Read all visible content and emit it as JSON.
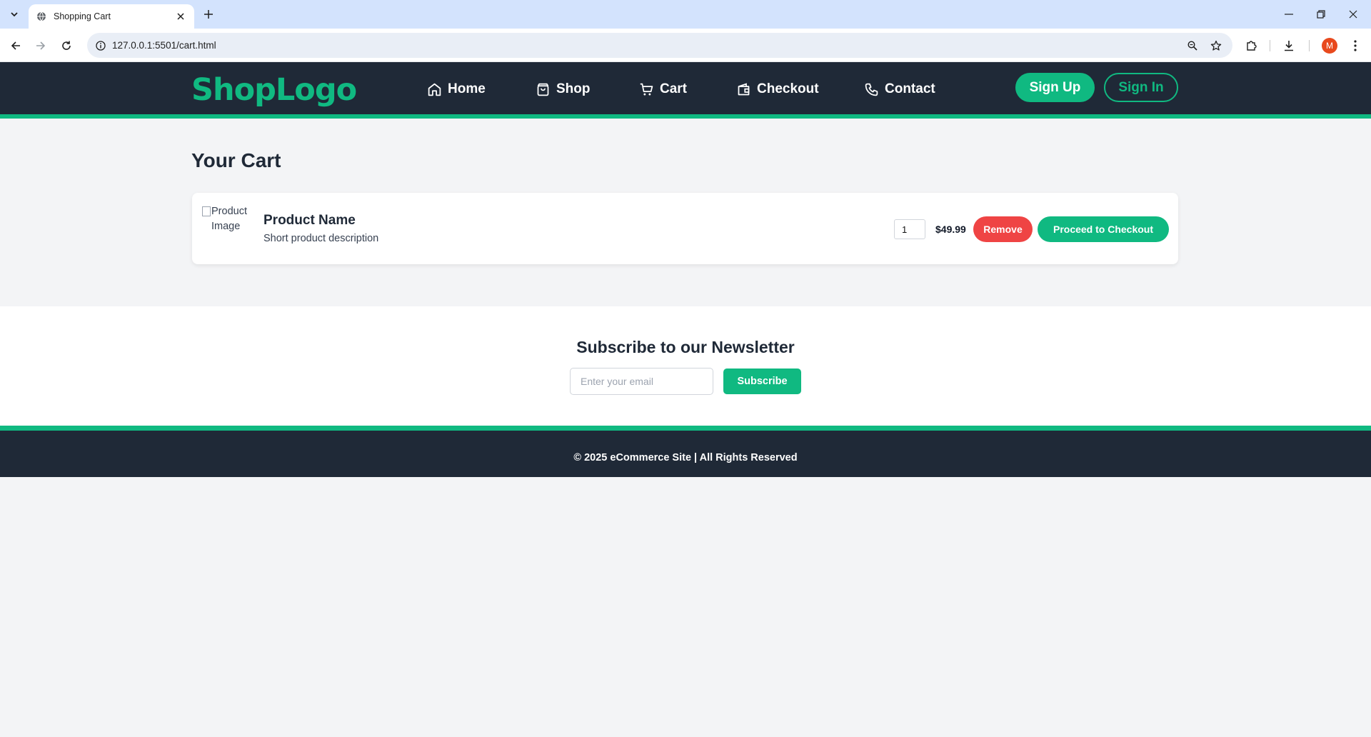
{
  "browser": {
    "tab_title": "Shopping Cart",
    "url": "127.0.0.1:5501/cart.html",
    "profile_initial": "M"
  },
  "header": {
    "logo": "ShopLogo",
    "nav": [
      {
        "label": "Home",
        "icon": "home-icon"
      },
      {
        "label": "Shop",
        "icon": "shopping-bag-icon"
      },
      {
        "label": "Cart",
        "icon": "cart-icon"
      },
      {
        "label": "Checkout",
        "icon": "wallet-icon"
      },
      {
        "label": "Contact",
        "icon": "phone-icon"
      }
    ],
    "signup_label": "Sign Up",
    "signin_label": "Sign In"
  },
  "cart": {
    "title": "Your Cart",
    "item": {
      "image_alt": "Product Image",
      "name": "Product Name",
      "description": "Short product description",
      "quantity": "1",
      "price": "$49.99"
    },
    "remove_label": "Remove",
    "checkout_label": "Proceed to Checkout"
  },
  "newsletter": {
    "title": "Subscribe to our Newsletter",
    "email_placeholder": "Enter your email",
    "button_label": "Subscribe"
  },
  "footer": {
    "text": "© 2025 eCommerce Site | All Rights Reserved"
  },
  "colors": {
    "brand": "#10b981",
    "header_bg": "#1f2937",
    "danger": "#ef4444",
    "page_bg": "#f3f4f6"
  }
}
